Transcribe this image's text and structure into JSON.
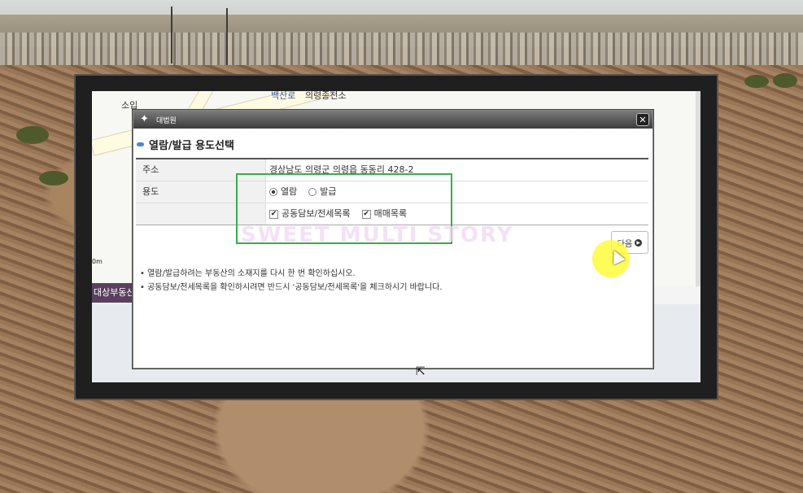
{
  "map": {
    "labels": [
      "소입",
      "백산로",
      "의령종전소"
    ],
    "scale_label": "0m",
    "left_tab_label": "대상부동산"
  },
  "dialog": {
    "logo_text": "대법원",
    "close_label": "✕",
    "title": "열람/발급 용도선택",
    "rows": {
      "address_label": "주소",
      "address_value": "경상남도 의령군 의령읍 동동리 428-2",
      "purpose_label": "용도",
      "purpose_options": [
        "열람",
        "발급"
      ],
      "selected_purpose": "열람",
      "extras": [
        "공동담보/전세목록",
        "매매목록"
      ]
    },
    "next_button_label": "다음",
    "notes": [
      "열람/발급하려는 부동산의 소재지를 다시 한 번 확인하십시오.",
      "공동담보/전세목록을 확인하시려면 반드시 '공동담보/전세목록'을 체크하시기 바랍니다."
    ]
  },
  "overlay": {
    "watermark": "SWEET MULTI STORY"
  },
  "colors": {
    "accent": "#4a88d8",
    "highlight": "#33b04a",
    "cursor": "#fffa3c"
  }
}
